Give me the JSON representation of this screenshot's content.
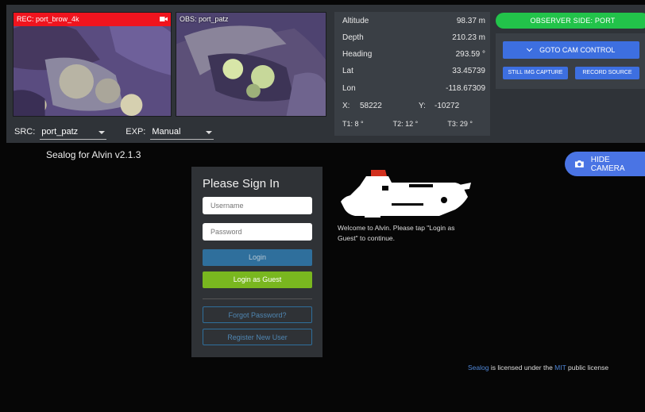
{
  "cameras": {
    "rec_label": "REC: port_brow_4k",
    "obs_label": "OBS: port_patz"
  },
  "source": {
    "src_label": "SRC:",
    "src_value": "port_patz",
    "exp_label": "EXP:",
    "exp_value": "Manual"
  },
  "telemetry": {
    "rows": [
      {
        "label": "Altitude",
        "value": "98.37 m"
      },
      {
        "label": "Depth",
        "value": "210.23 m"
      },
      {
        "label": "Heading",
        "value": "293.59 °"
      },
      {
        "label": "Lat",
        "value": "33.45739"
      },
      {
        "label": "Lon",
        "value": "-118.67309"
      }
    ],
    "x_label": "X:",
    "x_value": "58222",
    "y_label": "Y:",
    "y_value": "-10272",
    "t1": "T1: 8 °",
    "t2": "T2: 12 °",
    "t3": "T3: 29 °"
  },
  "controls": {
    "observer_side": "OBSERVER SIDE: PORT",
    "goto_cam_control": "GOTO CAM CONTROL",
    "still_img_capture": "STILL IMG CAPTURE",
    "record_source": "RECORD SOURCE"
  },
  "app": {
    "version": "Sealog for Alvin v2.1.3",
    "hide_camera": "HIDE CAMERA"
  },
  "signin": {
    "title": "Please Sign In",
    "username_placeholder": "Username",
    "password_placeholder": "Password",
    "login": "Login",
    "guest": "Login as Guest",
    "forgot": "Forgot Password?",
    "register": "Register New User"
  },
  "welcome": "Welcome to Alvin. Please tap \"Login as Guest\" to continue.",
  "license": {
    "sealog": "Sealog",
    "text1": " is licensed under the ",
    "mit": "MIT",
    "text2": " public license"
  },
  "colors": {
    "rec_red": "#f0141e",
    "observer_green": "#22c34a",
    "button_blue": "#3d6fe0",
    "guest_green": "#79b71f",
    "login_blue": "#2f6f9c",
    "submarine_red": "#d2301e"
  }
}
